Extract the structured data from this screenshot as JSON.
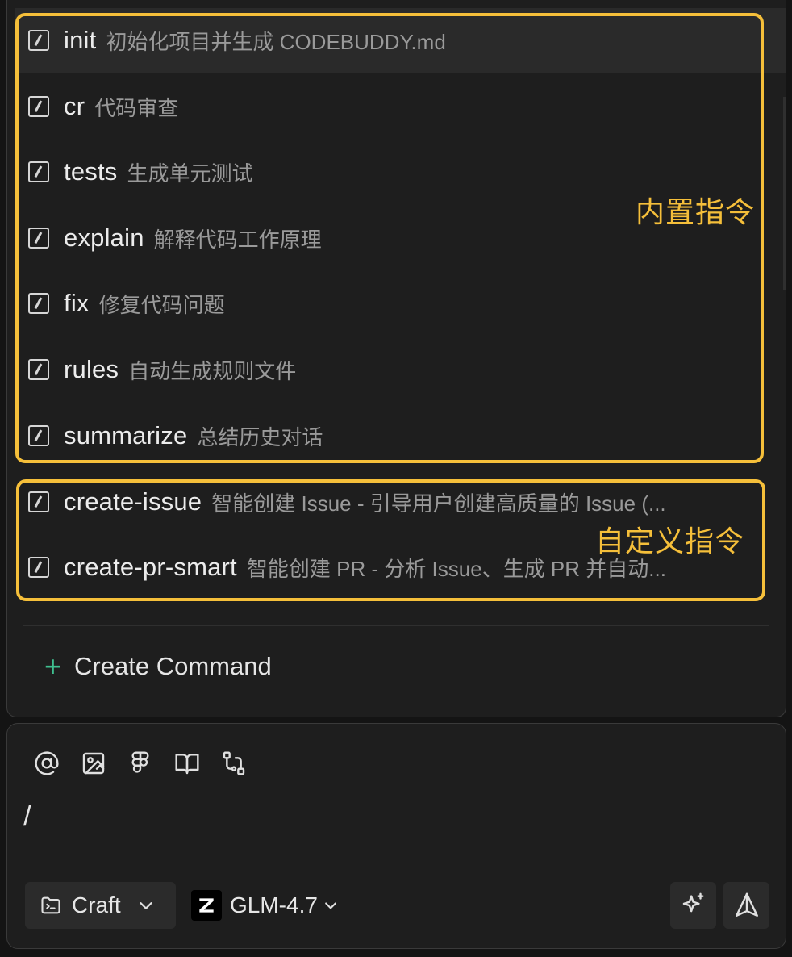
{
  "commands": [
    {
      "name": "init",
      "desc": "初始化项目并生成 CODEBUDDY.md"
    },
    {
      "name": "cr",
      "desc": "代码审查"
    },
    {
      "name": "tests",
      "desc": "生成单元测试"
    },
    {
      "name": "explain",
      "desc": "解释代码工作原理"
    },
    {
      "name": "fix",
      "desc": "修复代码问题"
    },
    {
      "name": "rules",
      "desc": "自动生成规则文件"
    },
    {
      "name": "summarize",
      "desc": "总结历史对话"
    },
    {
      "name": "create-issue",
      "desc": "智能创建 Issue - 引导用户创建高质量的 Issue (..."
    },
    {
      "name": "create-pr-smart",
      "desc": "智能创建 PR - 分析 Issue、生成 PR 并自动..."
    }
  ],
  "create_command": {
    "icon": "plus-icon",
    "label": "Create Command"
  },
  "annotations": {
    "builtin": "内置指令",
    "custom": "自定义指令",
    "color": "#f5bf3a"
  },
  "toolbar": {
    "icons": [
      "at-icon",
      "image-icon",
      "figma-icon",
      "book-icon",
      "workflow-icon"
    ]
  },
  "input": {
    "value": "/"
  },
  "mode": {
    "label": "Craft",
    "icon": "folder-terminal-icon"
  },
  "model": {
    "label": "GLM-4.7",
    "icon": "zhipu-logo-icon"
  },
  "actions": {
    "sparkle": "sparkle-icon",
    "send": "send-icon"
  },
  "colors": {
    "background": "#141414",
    "panel": "#1e1e1e",
    "accent_plus": "#3fbf8f"
  }
}
